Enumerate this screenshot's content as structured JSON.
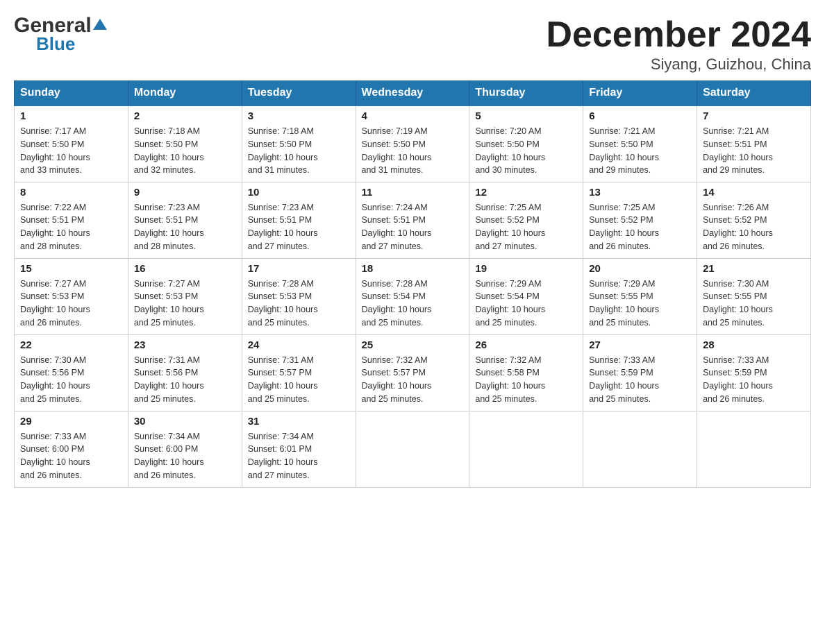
{
  "logo": {
    "general": "General",
    "blue": "Blue"
  },
  "title": "December 2024",
  "subtitle": "Siyang, Guizhou, China",
  "headers": [
    "Sunday",
    "Monday",
    "Tuesday",
    "Wednesday",
    "Thursday",
    "Friday",
    "Saturday"
  ],
  "weeks": [
    [
      {
        "day": "1",
        "sunrise": "7:17 AM",
        "sunset": "5:50 PM",
        "daylight": "10 hours and 33 minutes."
      },
      {
        "day": "2",
        "sunrise": "7:18 AM",
        "sunset": "5:50 PM",
        "daylight": "10 hours and 32 minutes."
      },
      {
        "day": "3",
        "sunrise": "7:18 AM",
        "sunset": "5:50 PM",
        "daylight": "10 hours and 31 minutes."
      },
      {
        "day": "4",
        "sunrise": "7:19 AM",
        "sunset": "5:50 PM",
        "daylight": "10 hours and 31 minutes."
      },
      {
        "day": "5",
        "sunrise": "7:20 AM",
        "sunset": "5:50 PM",
        "daylight": "10 hours and 30 minutes."
      },
      {
        "day": "6",
        "sunrise": "7:21 AM",
        "sunset": "5:50 PM",
        "daylight": "10 hours and 29 minutes."
      },
      {
        "day": "7",
        "sunrise": "7:21 AM",
        "sunset": "5:51 PM",
        "daylight": "10 hours and 29 minutes."
      }
    ],
    [
      {
        "day": "8",
        "sunrise": "7:22 AM",
        "sunset": "5:51 PM",
        "daylight": "10 hours and 28 minutes."
      },
      {
        "day": "9",
        "sunrise": "7:23 AM",
        "sunset": "5:51 PM",
        "daylight": "10 hours and 28 minutes."
      },
      {
        "day": "10",
        "sunrise": "7:23 AM",
        "sunset": "5:51 PM",
        "daylight": "10 hours and 27 minutes."
      },
      {
        "day": "11",
        "sunrise": "7:24 AM",
        "sunset": "5:51 PM",
        "daylight": "10 hours and 27 minutes."
      },
      {
        "day": "12",
        "sunrise": "7:25 AM",
        "sunset": "5:52 PM",
        "daylight": "10 hours and 27 minutes."
      },
      {
        "day": "13",
        "sunrise": "7:25 AM",
        "sunset": "5:52 PM",
        "daylight": "10 hours and 26 minutes."
      },
      {
        "day": "14",
        "sunrise": "7:26 AM",
        "sunset": "5:52 PM",
        "daylight": "10 hours and 26 minutes."
      }
    ],
    [
      {
        "day": "15",
        "sunrise": "7:27 AM",
        "sunset": "5:53 PM",
        "daylight": "10 hours and 26 minutes."
      },
      {
        "day": "16",
        "sunrise": "7:27 AM",
        "sunset": "5:53 PM",
        "daylight": "10 hours and 25 minutes."
      },
      {
        "day": "17",
        "sunrise": "7:28 AM",
        "sunset": "5:53 PM",
        "daylight": "10 hours and 25 minutes."
      },
      {
        "day": "18",
        "sunrise": "7:28 AM",
        "sunset": "5:54 PM",
        "daylight": "10 hours and 25 minutes."
      },
      {
        "day": "19",
        "sunrise": "7:29 AM",
        "sunset": "5:54 PM",
        "daylight": "10 hours and 25 minutes."
      },
      {
        "day": "20",
        "sunrise": "7:29 AM",
        "sunset": "5:55 PM",
        "daylight": "10 hours and 25 minutes."
      },
      {
        "day": "21",
        "sunrise": "7:30 AM",
        "sunset": "5:55 PM",
        "daylight": "10 hours and 25 minutes."
      }
    ],
    [
      {
        "day": "22",
        "sunrise": "7:30 AM",
        "sunset": "5:56 PM",
        "daylight": "10 hours and 25 minutes."
      },
      {
        "day": "23",
        "sunrise": "7:31 AM",
        "sunset": "5:56 PM",
        "daylight": "10 hours and 25 minutes."
      },
      {
        "day": "24",
        "sunrise": "7:31 AM",
        "sunset": "5:57 PM",
        "daylight": "10 hours and 25 minutes."
      },
      {
        "day": "25",
        "sunrise": "7:32 AM",
        "sunset": "5:57 PM",
        "daylight": "10 hours and 25 minutes."
      },
      {
        "day": "26",
        "sunrise": "7:32 AM",
        "sunset": "5:58 PM",
        "daylight": "10 hours and 25 minutes."
      },
      {
        "day": "27",
        "sunrise": "7:33 AM",
        "sunset": "5:59 PM",
        "daylight": "10 hours and 25 minutes."
      },
      {
        "day": "28",
        "sunrise": "7:33 AM",
        "sunset": "5:59 PM",
        "daylight": "10 hours and 26 minutes."
      }
    ],
    [
      {
        "day": "29",
        "sunrise": "7:33 AM",
        "sunset": "6:00 PM",
        "daylight": "10 hours and 26 minutes."
      },
      {
        "day": "30",
        "sunrise": "7:34 AM",
        "sunset": "6:00 PM",
        "daylight": "10 hours and 26 minutes."
      },
      {
        "day": "31",
        "sunrise": "7:34 AM",
        "sunset": "6:01 PM",
        "daylight": "10 hours and 27 minutes."
      },
      {
        "day": "",
        "sunrise": "",
        "sunset": "",
        "daylight": ""
      },
      {
        "day": "",
        "sunrise": "",
        "sunset": "",
        "daylight": ""
      },
      {
        "day": "",
        "sunrise": "",
        "sunset": "",
        "daylight": ""
      },
      {
        "day": "",
        "sunrise": "",
        "sunset": "",
        "daylight": ""
      }
    ]
  ],
  "labels": {
    "sunrise": "Sunrise: ",
    "sunset": "Sunset: ",
    "daylight": "Daylight: "
  }
}
